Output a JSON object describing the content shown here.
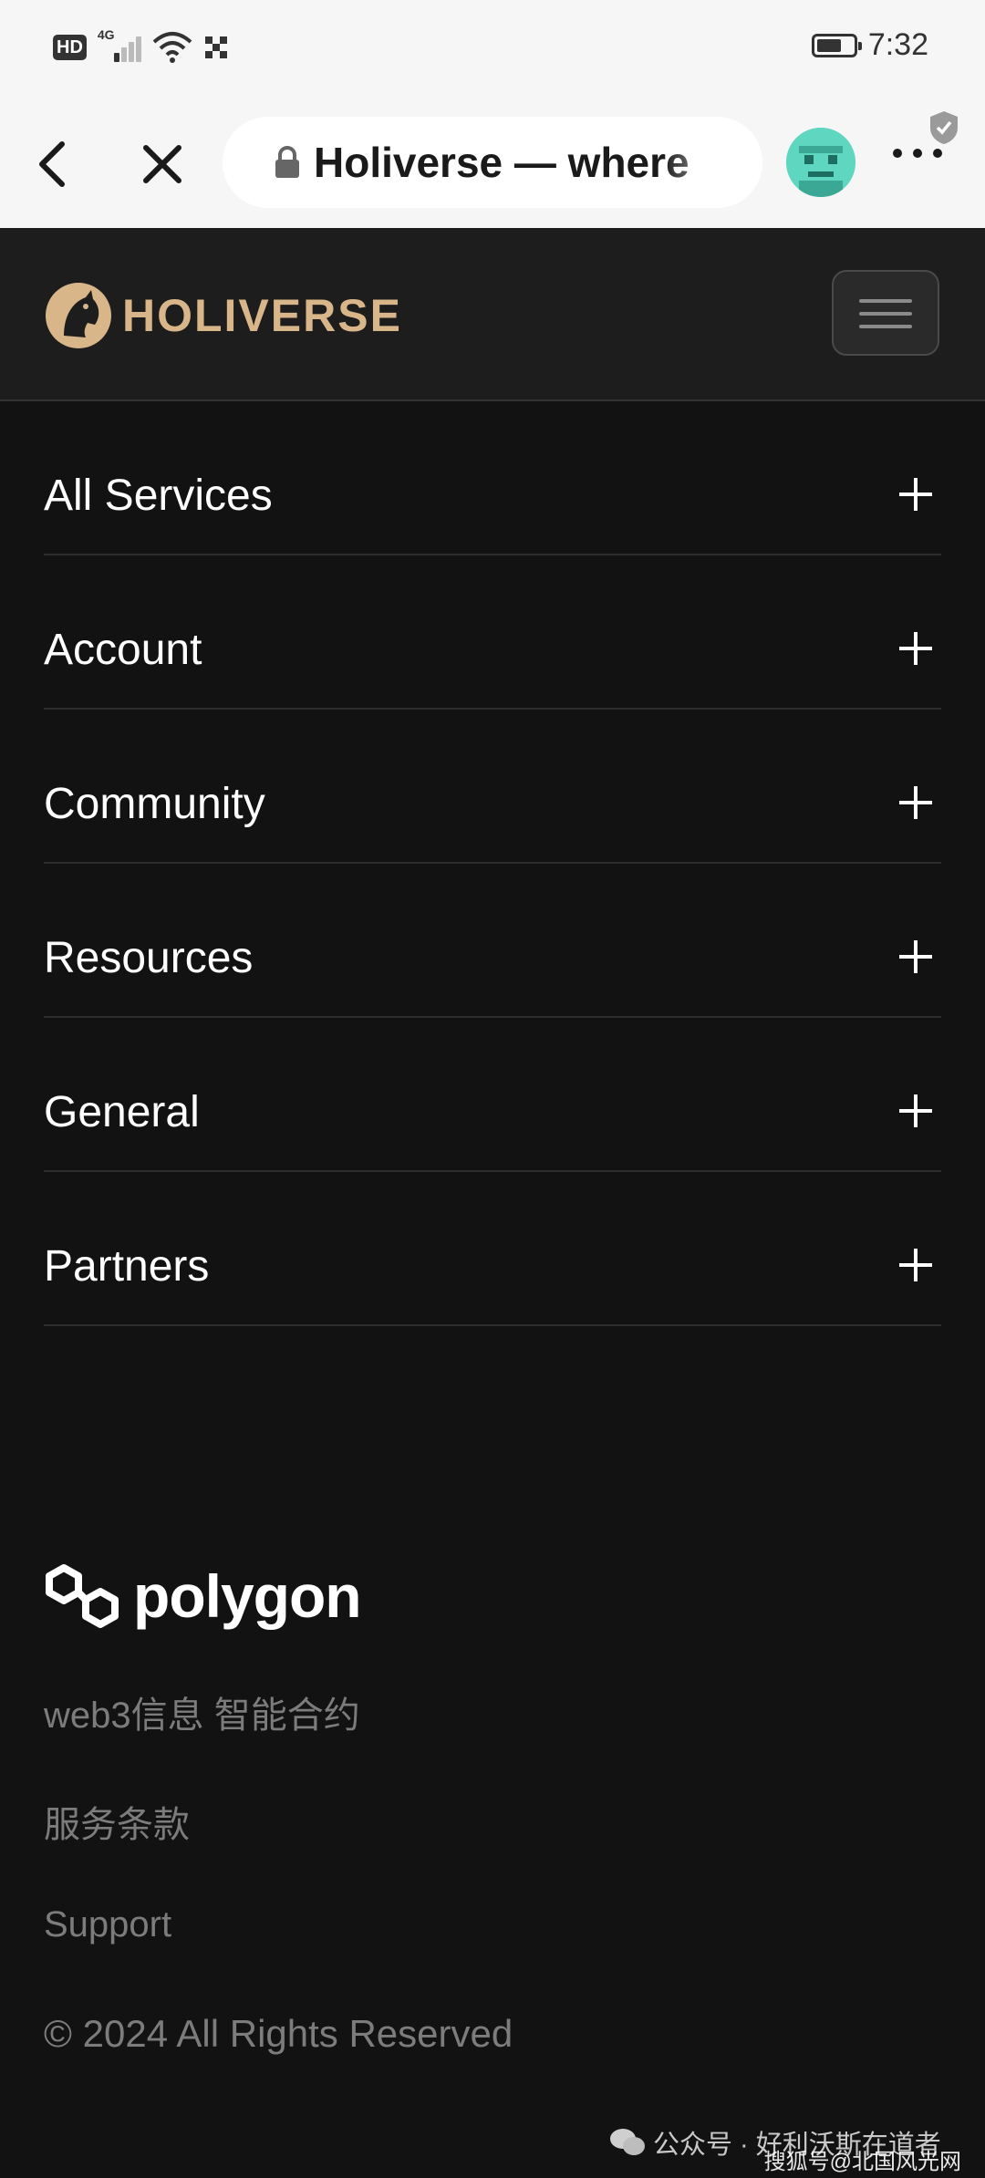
{
  "status_bar": {
    "hd_label": "HD",
    "network_label": "4G",
    "time": "7:32",
    "battery_level": 0.7
  },
  "browser": {
    "url_title": "Holiverse — where",
    "back_icon": "chevron-left-icon",
    "close_icon": "close-icon",
    "lock_icon": "lock-icon",
    "more_icon": "more-horizontal-icon",
    "shield_icon": "shield-check-icon"
  },
  "site": {
    "brand": "HOLIVERSE",
    "brand_color": "#d9b58a",
    "menu_icon": "hamburger-menu-icon"
  },
  "nav": {
    "items": [
      {
        "label": "All Services"
      },
      {
        "label": "Account"
      },
      {
        "label": "Community"
      },
      {
        "label": "Resources"
      },
      {
        "label": "General"
      },
      {
        "label": "Partners"
      }
    ]
  },
  "footer": {
    "partner_logo": "polygon",
    "links": [
      {
        "label": "web3信息 智能合约"
      },
      {
        "label": "服务条款"
      },
      {
        "label": "Support"
      }
    ],
    "copyright": "© 2024 All Rights Reserved"
  },
  "watermark": {
    "primary": "公众号 · 好利沃斯在道者",
    "secondary": "搜狐号@北国风光网"
  }
}
